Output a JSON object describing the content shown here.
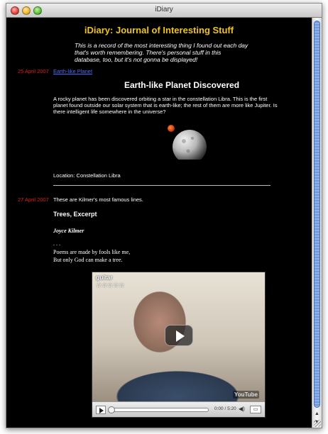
{
  "window": {
    "title": "iDiary"
  },
  "page": {
    "title": "iDiary: Journal of Interesting Stuff",
    "subtitle": "This is a record of the most interesting thing I found out each day that's worth remembering. There's personal stuff in this database, too, but it's not gonna be displayed!"
  },
  "entries": [
    {
      "date": "25 April 2007",
      "link": "Earth-like Planet",
      "heading": "Earth-like Planet Discovered",
      "body": "A rocky planet has been discovered orbiting a star in the constellation Libra. This is the first planet found outside our solar system that is earth-like; the rest of them are more like Jupiter. Is there intelligent life somewhere in the universe?",
      "location": "Location: Constellation Libra"
    },
    {
      "date": "27 April 2007",
      "intro": "These are Kilmer's most famous lines.",
      "poem_title": "Trees, Excerpt",
      "author": "Joyce Kilmer",
      "dots": ". . .",
      "lines": [
        "Poems are made by fools like me,",
        "But only God can make a tree."
      ],
      "video": {
        "title": "guitar",
        "stars": "☆☆☆☆☆",
        "time": "0:00 / 5:20",
        "logo": "YouTube",
        "progress": 0
      }
    }
  ],
  "icons": {
    "play": "play-icon",
    "volume": "volume-icon",
    "fullscreen": "fullscreen-icon"
  }
}
